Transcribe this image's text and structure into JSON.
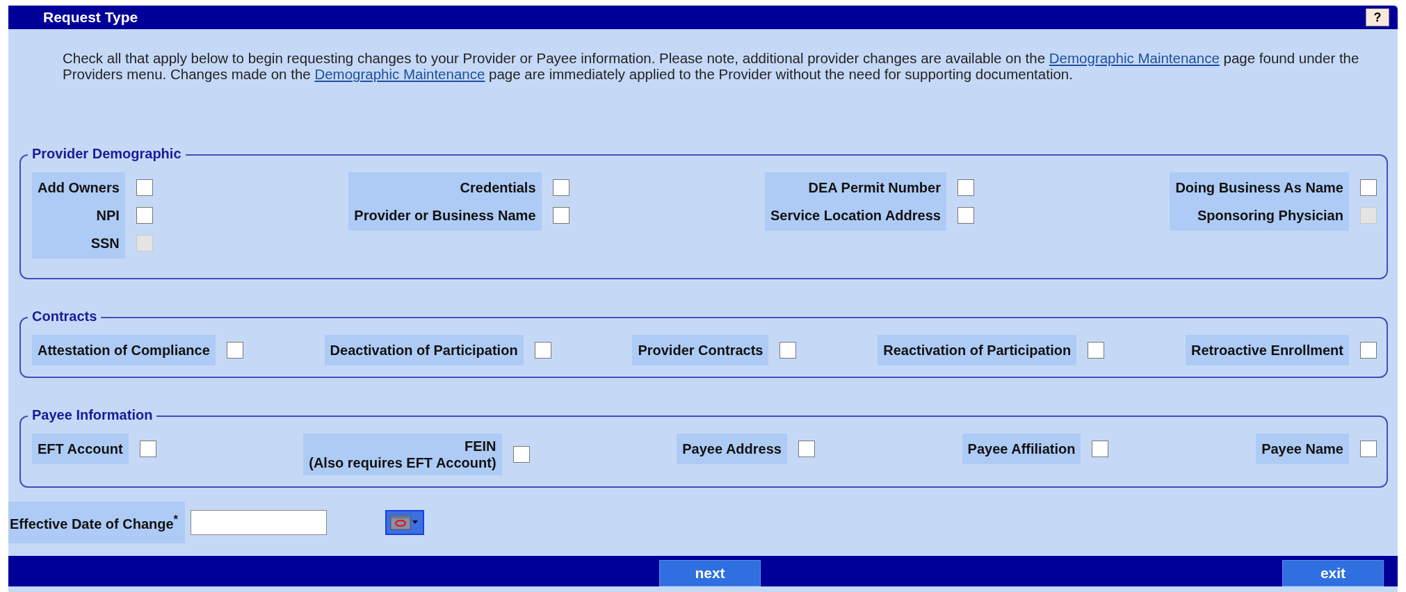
{
  "window": {
    "title": "Request Type",
    "help_button": "?"
  },
  "intro": [
    {
      "kind": "text",
      "text": "Check all that apply below to begin requesting changes to your Provider or Payee information. Please note, additional provider changes are available on the "
    },
    {
      "kind": "link",
      "text": "Demographic Maintenance"
    },
    {
      "kind": "text",
      "text": " page found under the Providers menu. Changes made on the "
    },
    {
      "kind": "link",
      "text": "Demographic Maintenance"
    },
    {
      "kind": "text",
      "text": " page are immediately applied to the Provider without the need for supporting documentation."
    }
  ],
  "sections": [
    {
      "title": "Provider Demographic",
      "columns": [
        [
          {
            "label": "Add Owners",
            "checked": false,
            "disabled": false
          },
          {
            "label": "NPI",
            "checked": false,
            "disabled": false
          },
          {
            "label": "SSN",
            "checked": false,
            "disabled": true
          }
        ],
        [
          {
            "label": "Credentials",
            "checked": false,
            "disabled": false
          },
          {
            "label": "Provider or Business Name",
            "checked": false,
            "disabled": false
          }
        ],
        [
          {
            "label": "DEA Permit Number",
            "checked": false,
            "disabled": false
          },
          {
            "label": "Service Location Address",
            "checked": false,
            "disabled": false
          }
        ],
        [
          {
            "label": "Doing Business As Name",
            "checked": false,
            "disabled": false
          },
          {
            "label": "Sponsoring Physician",
            "checked": false,
            "disabled": true
          }
        ]
      ]
    },
    {
      "title": "Contracts",
      "columns": [
        [
          {
            "label": "Attestation of Compliance",
            "checked": false,
            "disabled": false
          }
        ],
        [
          {
            "label": "Deactivation of Participation",
            "checked": false,
            "disabled": false
          }
        ],
        [
          {
            "label": "Provider Contracts",
            "checked": false,
            "disabled": false
          }
        ],
        [
          {
            "label": "Reactivation of Participation",
            "checked": false,
            "disabled": false
          }
        ],
        [
          {
            "label": "Retroactive Enrollment",
            "checked": false,
            "disabled": false
          }
        ]
      ]
    },
    {
      "title": "Payee Information",
      "columns": [
        [
          {
            "label": "EFT Account",
            "checked": false,
            "disabled": false
          }
        ],
        [
          {
            "label": "FEIN",
            "note": "(Also requires EFT Account)",
            "checked": false,
            "disabled": false
          }
        ],
        [
          {
            "label": "Payee Address",
            "checked": false,
            "disabled": false
          }
        ],
        [
          {
            "label": "Payee Affiliation",
            "checked": false,
            "disabled": false
          }
        ],
        [
          {
            "label": "Payee Name",
            "checked": false,
            "disabled": false
          }
        ]
      ]
    }
  ],
  "effective_date": {
    "label": "Effective Date of Change$^{*}$"
  },
  "buttons": [
    {
      "label": "next",
      "kind": "center"
    },
    {
      "label": "exit",
      "kind": "right"
    }
  ]
}
